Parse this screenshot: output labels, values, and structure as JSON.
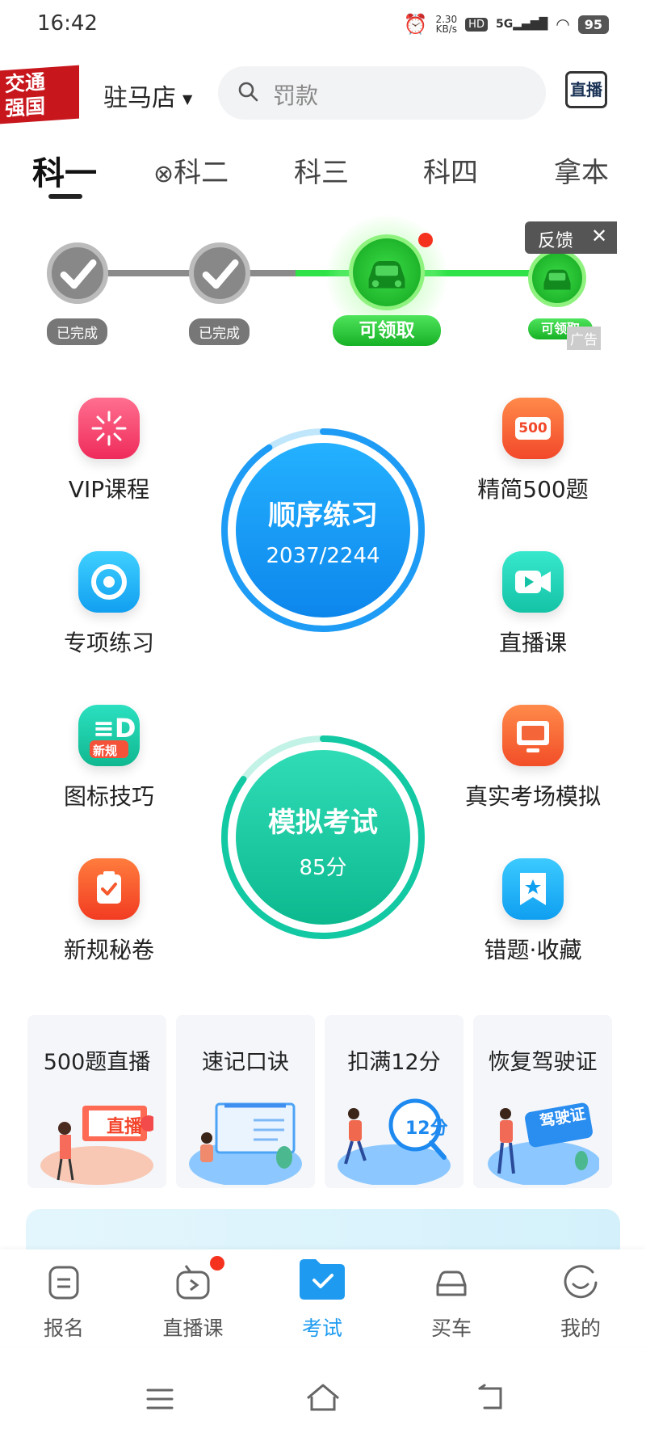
{
  "status_bar": {
    "time": "16:42",
    "net_speed": "2.30",
    "net_unit": "KB/s",
    "hd": "HD",
    "signal": "5G",
    "battery": "95"
  },
  "header": {
    "logo_line1": "交通",
    "logo_line2": "强国",
    "city": "驻马店",
    "search_placeholder": "罚款",
    "live_button": "直播"
  },
  "tabs": [
    {
      "label": "科一",
      "active": true
    },
    {
      "label": "科二",
      "active": false
    },
    {
      "label": "科三",
      "active": false
    },
    {
      "label": "科四",
      "active": false
    },
    {
      "label": "拿本",
      "active": false
    }
  ],
  "progress": {
    "nodes": [
      {
        "label": "已完成",
        "state": "done"
      },
      {
        "label": "已完成",
        "state": "done"
      },
      {
        "label": "可领取",
        "state": "claim"
      },
      {
        "label": "可领取",
        "state": "claim"
      }
    ],
    "feedback": "反馈",
    "ad": "广告"
  },
  "grid": {
    "left": [
      {
        "label": "VIP课程",
        "icon": "vip-icon",
        "color": "#f3436b"
      },
      {
        "label": "专项练习",
        "icon": "target-icon",
        "color": "#1ab0f0"
      },
      {
        "label": "图标技巧",
        "icon": "sign-icon",
        "color": "#16c9a6",
        "badge": "新规"
      },
      {
        "label": "新规秘卷",
        "icon": "clipboard-icon",
        "color": "#f5582c"
      }
    ],
    "right": [
      {
        "label": "精简500题",
        "icon": "500-icon",
        "color": "#f5602f",
        "badge": "500"
      },
      {
        "label": "直播课",
        "icon": "video-icon",
        "color": "#1ccfb8"
      },
      {
        "label": "真实考场模拟",
        "icon": "monitor-icon",
        "color": "#f6642e"
      },
      {
        "label": "错题·收藏",
        "icon": "bookmark-star-icon",
        "color": "#1aa9f2"
      }
    ],
    "sequential": {
      "title": "顺序练习",
      "progress": "2037/2244",
      "done": 2037,
      "total": 2244
    },
    "mock_exam": {
      "title": "模拟考试",
      "score": "85分",
      "score_value": 85
    }
  },
  "cards": [
    {
      "title": "500题直播",
      "art_text": "直播"
    },
    {
      "title": "速记口诀"
    },
    {
      "title": "扣满12分",
      "art_text": "12分"
    },
    {
      "title": "恢复驾驶证",
      "art_text": "驾驶证"
    }
  ],
  "bottom_nav": [
    {
      "label": "报名",
      "icon": "signup-icon",
      "active": false
    },
    {
      "label": "直播课",
      "icon": "tv-icon",
      "active": false,
      "dot": true
    },
    {
      "label": "考试",
      "icon": "folder-check-icon",
      "active": true
    },
    {
      "label": "买车",
      "icon": "car-icon",
      "active": false
    },
    {
      "label": "我的",
      "icon": "smile-icon",
      "active": false
    }
  ]
}
